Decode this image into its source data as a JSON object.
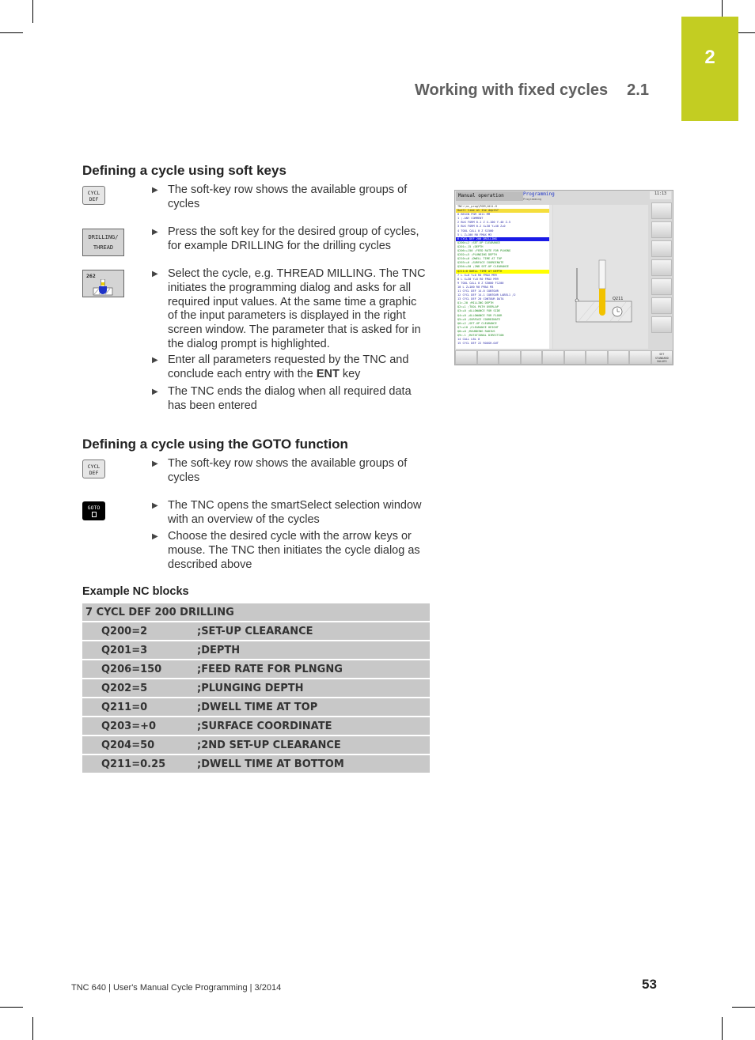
{
  "header": {
    "chapter_number": "2",
    "running_title": "Working with fixed cycles",
    "section_number": "2.1",
    "chapter_tab_color": "#c3cd22"
  },
  "section1": {
    "title": "Defining a cycle using soft keys",
    "keys": {
      "cycl_def": [
        "CYCL",
        "DEF"
      ],
      "drilling_thread": [
        "DRILLING/",
        "THREAD"
      ],
      "cycle_262": "262"
    },
    "steps": [
      "The soft-key row shows the available groups of cycles",
      "Press the soft key for the desired group of cycles, for example DRILLING for the drilling cycles",
      "Select the cycle, e.g. THREAD MILLING. The TNC initiates the programming dialog and asks for all required input values. At the same time a graphic of the input parameters is displayed in the right screen window. The parameter that is asked for in the dialog prompt is highlighted.",
      {
        "before": "Enter all parameters requested by the TNC and conclude each entry with the ",
        "bold": "ENT",
        "after": " key"
      },
      "The TNC ends the dialog when all required data has been entered"
    ]
  },
  "section2": {
    "title": "Defining a cycle using the GOTO function",
    "keys": {
      "cycl_def": [
        "CYCL",
        "DEF"
      ],
      "goto": "GOTO"
    },
    "steps": [
      "The soft-key row shows the available groups of cycles",
      "The TNC opens the smartSelect selection window with an overview of the cycles",
      "Choose the desired cycle with the arrow keys or mouse. The TNC then initiates the cycle dialog as described above"
    ]
  },
  "example": {
    "title": "Example NC blocks",
    "header_row": "7 CYCL DEF 200 DRILLING",
    "rows": [
      {
        "param": "Q200=2",
        "comment": ";SET-UP CLEARANCE"
      },
      {
        "param": "Q201=3",
        "comment": ";DEPTH"
      },
      {
        "param": "Q206=150",
        "comment": ";FEED RATE FOR PLNGNG"
      },
      {
        "param": "Q202=5",
        "comment": ";PLUNGING DEPTH"
      },
      {
        "param": "Q211=0",
        "comment": ";DWELL TIME AT TOP"
      },
      {
        "param": "Q203=+0",
        "comment": ";SURFACE COORDINATE"
      },
      {
        "param": "Q204=50",
        "comment": ";2ND SET-UP CLEARANCE"
      },
      {
        "param": "Q211=0.25",
        "comment": ";DWELL TIME AT BOTTOM"
      }
    ]
  },
  "tnc_screen": {
    "mode_left": "Manual operation",
    "mode_right": "Programming",
    "mode_right_sub": "Programming",
    "clock": "11:13",
    "file_path": "TNC:\\nc_prog\\PGM\\1011.H",
    "prompt": "Dwell time at the depth?",
    "lines": [
      {
        "t": "0  BEGIN PGM 1011 MM",
        "k": ""
      },
      {
        "t": "1  ;-ANY COMMENT",
        "k": ""
      },
      {
        "t": "2  BLK FORM 0.1 Z X-100 Y-40 Z-5",
        "k": ""
      },
      {
        "t": "3  BLK FORM 0.2  X+30  Y+40  Z+0",
        "k": ""
      },
      {
        "t": "4  TOOL CALL 0 Z S1500",
        "k": ""
      },
      {
        "t": "5  L  Z+100 R0 FMAX M3",
        "k": ""
      },
      {
        "t": "6  CYCL DEF 200 DRILLING",
        "k": "hl"
      },
      {
        "t": "    Q200=+2    ;SET-UP CLEARANCE",
        "k": "par"
      },
      {
        "t": "    Q201=-15   ;DEPTH",
        "k": "par"
      },
      {
        "t": "    Q206=+150  ;FEED RATE FOR PLNGNG",
        "k": "par"
      },
      {
        "t": "    Q202=+5    ;PLUNGING DEPTH",
        "k": "par"
      },
      {
        "t": "    Q210=+0    ;DWELL TIME AT TOP",
        "k": "par"
      },
      {
        "t": "    Q203=+0    ;SURFACE COORDINATE",
        "k": "par"
      },
      {
        "t": "    Q204=+50   ;2ND SET-UP CLEARANCE",
        "k": "par"
      },
      {
        "t": "    Q211=0       DWELL TIME AT DEPTH",
        "k": "cur"
      },
      {
        "t": "7  L  X+0  Y+0 R0 FMAX M99",
        "k": ""
      },
      {
        "t": "8  L  X+30  Y+0 R0 FMAX M99",
        "k": ""
      },
      {
        "t": "9  TOOL CALL 0 Z S3000 F1200",
        "k": ""
      },
      {
        "t": "10 L  Z+100 R0 FMAX M3",
        "k": ""
      },
      {
        "t": "11 CYCL DEF 14.0 CONTOUR",
        "k": ""
      },
      {
        "t": "12 CYCL DEF 14.1 CONTOUR LABEL1 /2",
        "k": ""
      },
      {
        "t": "13 CYCL DEF 20 CONTOUR DATA",
        "k": ""
      },
      {
        "t": "    Q1=-20    ;MILLING DEPTH",
        "k": "par"
      },
      {
        "t": "    Q2=+1     ;TOOL PATH OVERLAP",
        "k": "par"
      },
      {
        "t": "    Q3=+0     ;ALLOWANCE FOR SIDE",
        "k": "par"
      },
      {
        "t": "    Q4=+0     ;ALLOWANCE FOR FLOOR",
        "k": "par"
      },
      {
        "t": "    Q5=+0     ;SURFACE COORDINATE",
        "k": "par"
      },
      {
        "t": "    Q6=+2     ;SET-UP CLEARANCE",
        "k": "par"
      },
      {
        "t": "    Q7=+10    ;CLEARANCE HEIGHT",
        "k": "par"
      },
      {
        "t": "    Q8=+0     ;ROUNDING RADIUS",
        "k": "par"
      },
      {
        "t": "    Q9=-1     ;ROTATIONAL DIRECTION",
        "k": "par"
      },
      {
        "t": "14 CALL LBL 0",
        "k": ""
      },
      {
        "t": "15 CYCL DEF 22 ROUGH-OUT",
        "k": ""
      }
    ],
    "graphic_label": "Q211",
    "softkey_last": [
      "SET",
      "STANDARD",
      "VALUES"
    ]
  },
  "footer": {
    "text": "TNC 640 | User's Manual Cycle Programming | 3/2014",
    "page_number": "53"
  }
}
